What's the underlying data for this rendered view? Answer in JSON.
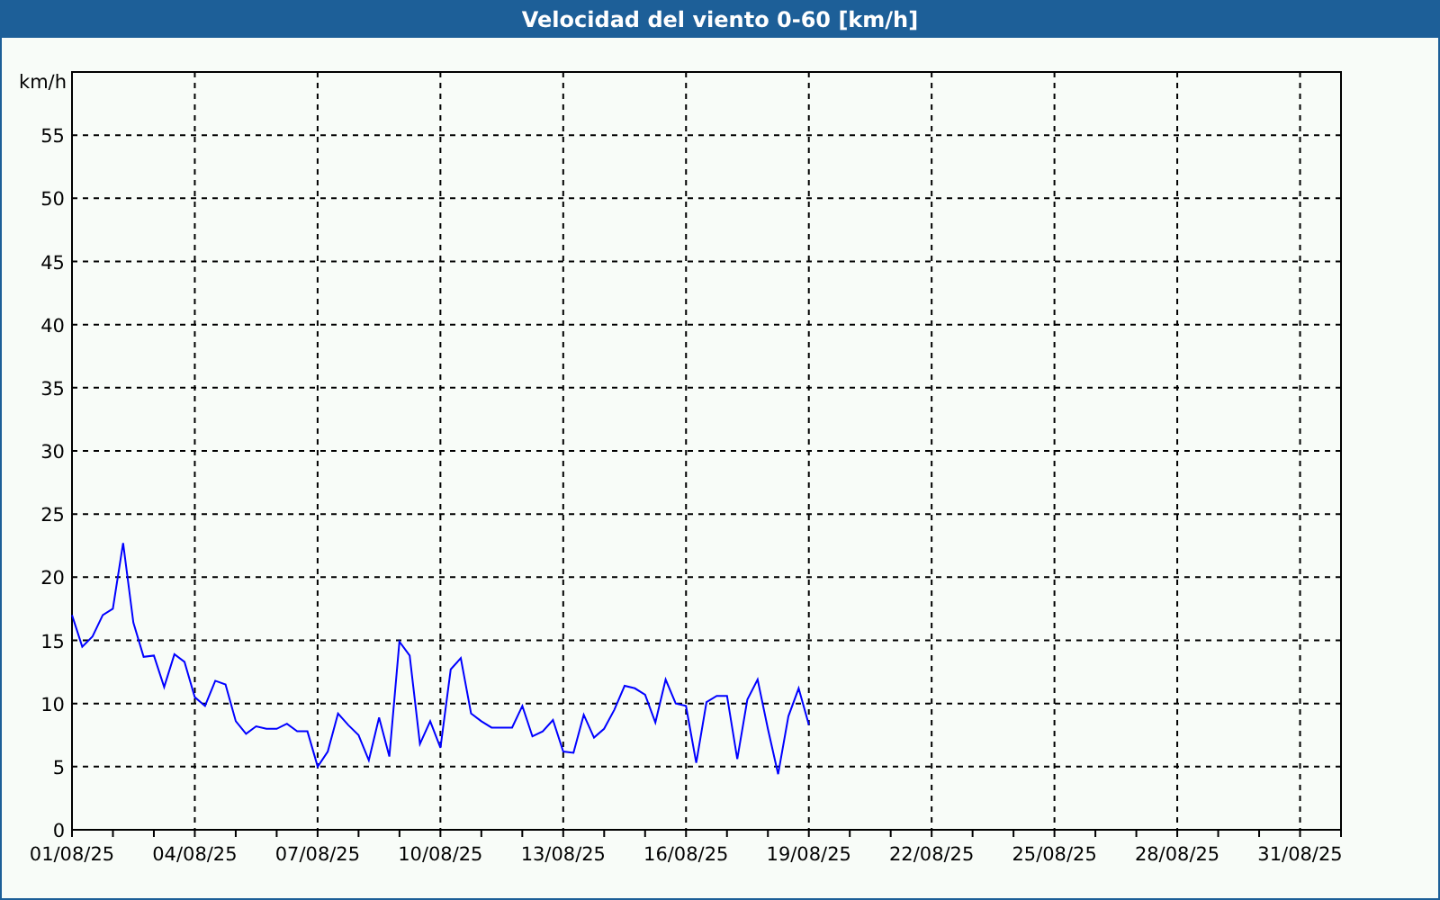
{
  "window": {
    "title": "Velocidad del viento 0-60 [km/h]"
  },
  "chart": {
    "chart_data": {
      "type": "line",
      "ylabel": "km/h",
      "grid": true,
      "categories": [
        "01/08/25",
        null,
        null,
        null,
        null,
        null,
        null,
        null,
        null,
        null,
        null,
        null,
        "04/08/25",
        null,
        null,
        null,
        null,
        null,
        null,
        null,
        null,
        null,
        null,
        null,
        "07/08/25",
        null,
        null,
        null,
        null,
        null,
        null,
        null,
        null,
        null,
        null,
        null,
        "10/08/25",
        null,
        null,
        null,
        null,
        null,
        null,
        null,
        null,
        null,
        null,
        null,
        "13/08/25",
        null,
        null,
        null,
        null,
        null,
        null,
        null,
        null,
        null,
        null,
        null,
        "16/08/25",
        null,
        null,
        null,
        null,
        null,
        null,
        null,
        null,
        null,
        null,
        null,
        "19/08/25",
        null,
        null,
        null,
        null,
        null,
        null,
        null,
        null,
        null,
        null,
        null,
        "22/08/25",
        null,
        null,
        null,
        null,
        null,
        null,
        null,
        null,
        null,
        null,
        null,
        "25/08/25",
        null,
        null,
        null,
        null,
        null,
        null,
        null,
        null,
        null,
        null,
        null,
        "28/08/25",
        null,
        null,
        null,
        null,
        null,
        null,
        null,
        null,
        null,
        null,
        null,
        "31/08/25",
        null,
        null,
        null,
        null
      ],
      "series": [
        {
          "color": "#0000ff",
          "values": [
            17,
            14.5,
            15.3,
            17,
            17.5,
            22.7,
            16.4,
            13.7,
            13.8,
            11.3,
            13.9,
            13.3,
            10.5,
            9.8,
            11.8,
            11.5,
            8.6,
            7.6,
            8.2,
            8,
            8,
            8.4,
            7.8,
            7.8,
            5,
            6.2,
            9.2,
            8.3,
            7.5,
            5.5,
            8.9,
            5.8,
            14.9,
            13.8,
            6.8,
            8.6,
            6.5,
            12.7,
            13.6,
            9.2,
            8.6,
            8.1,
            8.1,
            8.1,
            9.8,
            7.4,
            7.8,
            8.7,
            6.2,
            6.1,
            9.1,
            7.3,
            8,
            9.5,
            11.4,
            11.2,
            10.7,
            8.5,
            11.9,
            10,
            9.8,
            5.3,
            10.1,
            10.6,
            10.6,
            5.6,
            10.3,
            11.9,
            8,
            4.4,
            9,
            11.2,
            8.3,
            null,
            null,
            null,
            null,
            null,
            null,
            null,
            null,
            null,
            null,
            null,
            null,
            null,
            null,
            null,
            null,
            null,
            null,
            null,
            null,
            null,
            null,
            null,
            null,
            null,
            null,
            null,
            null,
            null,
            null,
            null,
            null,
            null,
            null,
            null,
            null,
            null,
            null,
            null,
            null,
            null,
            null,
            null,
            null,
            null,
            null,
            null,
            null,
            null,
            null,
            null,
            null
          ]
        }
      ],
      "ylim": [
        0,
        60
      ],
      "yticks": [
        0,
        5,
        10,
        15,
        20,
        25,
        30,
        35,
        40,
        45,
        50,
        55
      ]
    }
  }
}
